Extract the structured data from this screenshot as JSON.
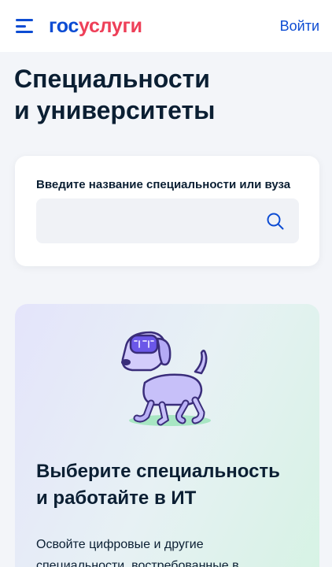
{
  "header": {
    "logo_part1": "гос",
    "logo_part2": "услуги",
    "login_label": "Войти"
  },
  "page": {
    "title_line1": "Специальности",
    "title_line2": "и университеты"
  },
  "search": {
    "label": "Введите название специальности или вуза",
    "value": "",
    "placeholder": ""
  },
  "promo": {
    "title_line1": "Выберите специальность",
    "title_line2": "и работайте в ИТ",
    "text_line1": "Освойте цифровые и другие",
    "text_line2": "специальности, востребованные в"
  },
  "colors": {
    "brand_blue": "#0d4cd3",
    "brand_red": "#ee3f58",
    "background": "#f3f5f9"
  }
}
